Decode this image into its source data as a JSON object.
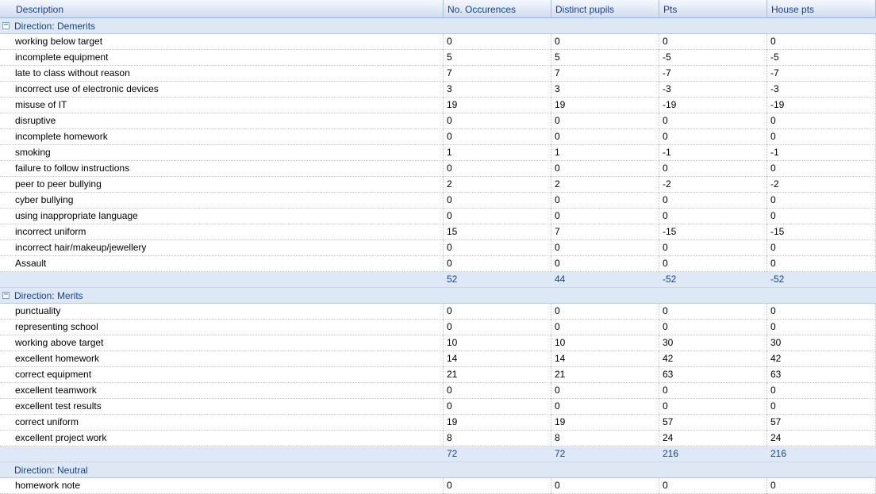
{
  "columns": [
    "Description",
    "No. Occurences",
    "Distinct pupils",
    "Pts",
    "House pts"
  ],
  "groups": [
    {
      "title": "Direction: Demerits",
      "collapse_icon": "minus-box-icon",
      "rows": [
        [
          "working below target",
          "0",
          "0",
          "0",
          "0"
        ],
        [
          "incomplete equipment",
          "5",
          "5",
          "-5",
          "-5"
        ],
        [
          "late to class without reason",
          "7",
          "7",
          "-7",
          "-7"
        ],
        [
          "incorrect use of electronic devices",
          "3",
          "3",
          "-3",
          "-3"
        ],
        [
          "misuse of IT",
          "19",
          "19",
          "-19",
          "-19"
        ],
        [
          "disruptive",
          "0",
          "0",
          "0",
          "0"
        ],
        [
          "incomplete homework",
          "0",
          "0",
          "0",
          "0"
        ],
        [
          "smoking",
          "1",
          "1",
          "-1",
          "-1"
        ],
        [
          "failure to follow instructions",
          "0",
          "0",
          "0",
          "0"
        ],
        [
          "peer to peer bullying",
          "2",
          "2",
          "-2",
          "-2"
        ],
        [
          "cyber bullying",
          "0",
          "0",
          "0",
          "0"
        ],
        [
          "using inappropriate language",
          "0",
          "0",
          "0",
          "0"
        ],
        [
          "incorrect uniform",
          "15",
          "7",
          "-15",
          "-15"
        ],
        [
          "incorrect hair/makeup/jewellery",
          "0",
          "0",
          "0",
          "0"
        ],
        [
          "Assault",
          "0",
          "0",
          "0",
          "0"
        ]
      ],
      "totals": [
        "52",
        "44",
        "-52",
        "-52"
      ]
    },
    {
      "title": "Direction: Merits",
      "collapse_icon": "minus-box-icon",
      "rows": [
        [
          "punctuality",
          "0",
          "0",
          "0",
          "0"
        ],
        [
          "representing school",
          "0",
          "0",
          "0",
          "0"
        ],
        [
          "working above target",
          "10",
          "10",
          "30",
          "30"
        ],
        [
          "excellent homework",
          "14",
          "14",
          "42",
          "42"
        ],
        [
          "correct equipment",
          "21",
          "21",
          "63",
          "63"
        ],
        [
          "excellent teamwork",
          "0",
          "0",
          "0",
          "0"
        ],
        [
          "excellent test results",
          "0",
          "0",
          "0",
          "0"
        ],
        [
          "correct uniform",
          "19",
          "19",
          "57",
          "57"
        ],
        [
          "excellent project work",
          "8",
          "8",
          "24",
          "24"
        ]
      ],
      "totals": [
        "72",
        "72",
        "216",
        "216"
      ]
    },
    {
      "title": "Direction: Neutral",
      "collapse_icon": "",
      "rows": [
        [
          "homework note",
          "0",
          "0",
          "0",
          "0"
        ]
      ],
      "totals": []
    }
  ]
}
